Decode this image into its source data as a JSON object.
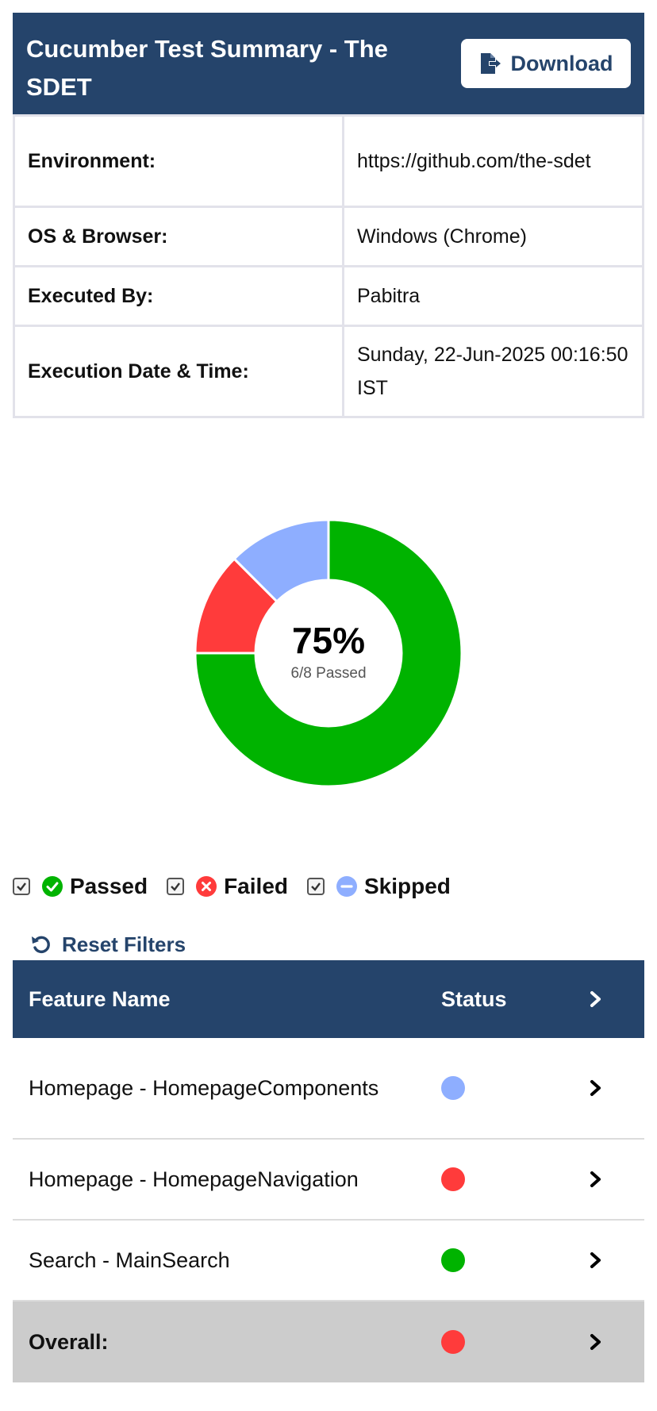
{
  "header": {
    "title": "Cucumber Test Summary - The SDET",
    "download_label": "Download"
  },
  "info": [
    {
      "label": "Environment:",
      "value": "https://github.com/the-sdet"
    },
    {
      "label": "OS & Browser:",
      "value": "Windows (Chrome)"
    },
    {
      "label": "Executed By:",
      "value": "Pabitra"
    },
    {
      "label": "Execution Date & Time:",
      "value": "Sunday, 22-Jun-2025 00:16:50 IST"
    }
  ],
  "chart_data": {
    "type": "pie",
    "slices": [
      {
        "label": "Passed",
        "value": 6,
        "color": "#00b300"
      },
      {
        "label": "Failed",
        "value": 1,
        "color": "#ff3b3b"
      },
      {
        "label": "Skipped",
        "value": 1,
        "color": "#8eaeff"
      }
    ],
    "center_percent": "75%",
    "center_subtext": "6/8 Passed"
  },
  "filters": [
    {
      "label": "Passed",
      "checked": true,
      "icon": "check-circle-icon",
      "color": "#00b300"
    },
    {
      "label": "Failed",
      "checked": true,
      "icon": "x-circle-icon",
      "color": "#ff3b3b"
    },
    {
      "label": "Skipped",
      "checked": true,
      "icon": "minus-circle-icon",
      "color": "#8eaeff"
    }
  ],
  "reset_label": "Reset Filters",
  "table": {
    "headers": [
      "Feature Name",
      "Status"
    ],
    "rows": [
      {
        "name": "Homepage - HomepageComponents",
        "status": "skipped",
        "color": "#8eaeff"
      },
      {
        "name": "Homepage - HomepageNavigation",
        "status": "failed",
        "color": "#ff3b3b"
      },
      {
        "name": "Search - MainSearch",
        "status": "passed",
        "color": "#00b300"
      }
    ],
    "overall": {
      "label": "Overall:",
      "status": "failed",
      "color": "#ff3b3b"
    }
  }
}
